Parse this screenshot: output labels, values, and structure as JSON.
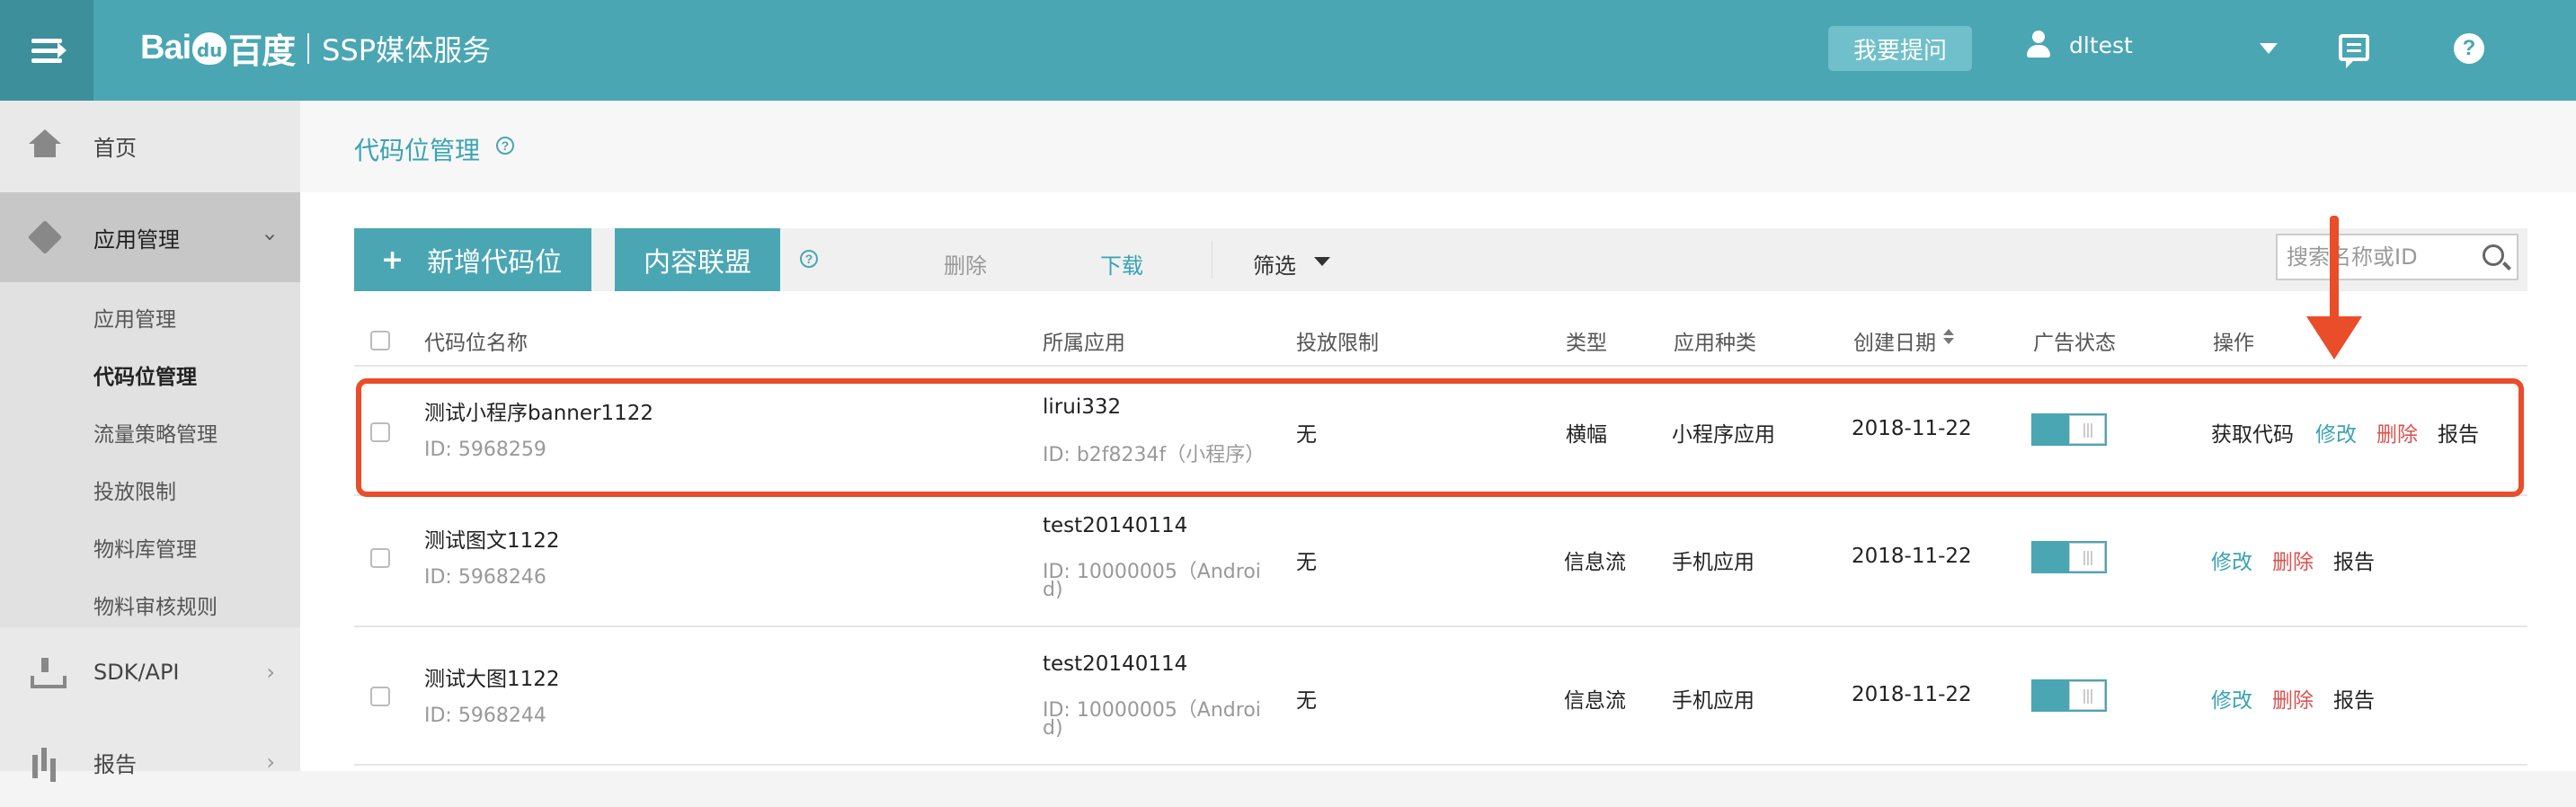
{
  "header": {
    "brand_logo_left": "Bai",
    "brand_logo_paw": "du",
    "brand_logo_right": "百度",
    "service_name": "SSP媒体服务",
    "ask_button": "我要提问",
    "username": "dltest",
    "accent_color": "#4aa6b3"
  },
  "sidebar": {
    "home": "首页",
    "app_management": "应用管理",
    "sub_items": [
      "应用管理",
      "代码位管理",
      "流量策略管理",
      "投放限制",
      "物料库管理",
      "物料审核规则"
    ],
    "sdk_api": "SDK/API",
    "report": "报告"
  },
  "page": {
    "title": "代码位管理"
  },
  "toolbar": {
    "new_button": "新增代码位",
    "alliance_button": "内容联盟",
    "delete": "删除",
    "download": "下载",
    "filter": "筛选",
    "search_placeholder": "搜索名称或ID"
  },
  "table": {
    "headers": [
      "代码位名称",
      "所属应用",
      "投放限制",
      "类型",
      "应用种类",
      "创建日期",
      "广告状态",
      "操作"
    ],
    "rows": [
      {
        "name": "测试小程序banner1122",
        "id": "ID: 5968259",
        "app": "lirui332",
        "app_id": "ID: b2f8234f（小程序）",
        "limit": "无",
        "type": "横幅",
        "kind": "小程序应用",
        "date": "2018-11-22",
        "ops": [
          "获取代码",
          "修改",
          "删除",
          "报告"
        ]
      },
      {
        "name": "测试图文1122",
        "id": "ID: 5968246",
        "app": "test20140114",
        "app_id_line1": "ID: 10000005（Androi",
        "app_id_line2": "d)",
        "limit": "无",
        "type": "信息流",
        "kind": "手机应用",
        "date": "2018-11-22",
        "ops": [
          "修改",
          "删除",
          "报告"
        ]
      },
      {
        "name": "测试大图1122",
        "id": "ID: 5968244",
        "app": "test20140114",
        "app_id_line1": "ID: 10000005（Androi",
        "app_id_line2": "d)",
        "limit": "无",
        "type": "信息流",
        "kind": "手机应用",
        "date": "2018-11-22",
        "ops": [
          "修改",
          "删除",
          "报告"
        ]
      }
    ]
  },
  "annotation_color": "#ea4d2a"
}
